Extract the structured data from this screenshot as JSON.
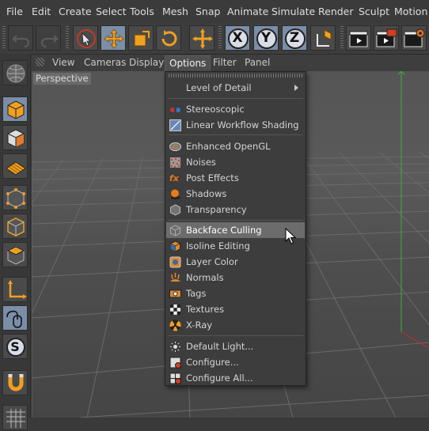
{
  "menubar": {
    "items": [
      "File",
      "Edit",
      "Create",
      "Select",
      "Tools",
      "Mesh",
      "Snap",
      "Animate",
      "Simulate",
      "Render",
      "Sculpt",
      "Motion T"
    ]
  },
  "toolbar": {
    "icons": [
      "undo-icon",
      "redo-icon",
      "live-selection-icon",
      "move-icon",
      "scale-icon",
      "rotate-icon",
      "last-tool-icon",
      "x-axis-icon",
      "y-axis-icon",
      "z-axis-icon",
      "coordinate-system-icon",
      "render-view-icon",
      "render-picture-viewer-icon",
      "render-settings-icon"
    ],
    "x_label": "X",
    "y_label": "Y",
    "z_label": "Z"
  },
  "viewport_menu": {
    "items": [
      "View",
      "Cameras",
      "Display",
      "Options",
      "Filter",
      "Panel"
    ],
    "open_item": "Options"
  },
  "viewport": {
    "camera_label": "Perspective"
  },
  "options_menu": {
    "items": [
      {
        "label": "Level of Detail",
        "icon": "none",
        "submenu": true
      },
      {
        "label": "Stereoscopic",
        "icon": "stereoscopic-icon"
      },
      {
        "label": "Linear Workflow Shading",
        "icon": "linear-workflow-icon"
      },
      {
        "label": "Enhanced OpenGL",
        "icon": "enhanced-opengl-icon"
      },
      {
        "label": "Noises",
        "icon": "noises-icon"
      },
      {
        "label": "Post Effects",
        "icon": "fx-icon"
      },
      {
        "label": "Shadows",
        "icon": "shadows-icon"
      },
      {
        "label": "Transparency",
        "icon": "transparency-icon"
      },
      {
        "label": "Backface Culling",
        "icon": "backface-culling-icon",
        "highlighted": true
      },
      {
        "label": "Isoline Editing",
        "icon": "isoline-editing-icon"
      },
      {
        "label": "Layer Color",
        "icon": "layer-color-icon"
      },
      {
        "label": "Normals",
        "icon": "normals-icon"
      },
      {
        "label": "Tags",
        "icon": "tags-icon"
      },
      {
        "label": "Textures",
        "icon": "textures-icon"
      },
      {
        "label": "X-Ray",
        "icon": "x-ray-icon"
      },
      {
        "label": "Default Light...",
        "icon": "default-light-icon"
      },
      {
        "label": "Configure...",
        "icon": "configure-icon"
      },
      {
        "label": "Configure All...",
        "icon": "configure-all-icon"
      }
    ]
  },
  "left_toolbar": {
    "icons": [
      "viewport-layout-icon",
      "model-mode-icon",
      "texture-mode-icon",
      "workplane-mode-icon",
      "points-mode-icon",
      "edges-mode-icon",
      "polygons-mode-icon",
      "axis-mode-icon",
      "tweak-mode-icon",
      "solo-mode-icon",
      "magnet-icon",
      "grid-icon"
    ],
    "solo_label": "S"
  },
  "colors": {
    "accent_selected": "#7a8ea8",
    "menu_highlight": "#6c6c6c",
    "axis_green": "#3fae3f",
    "axis_red": "#c0302c"
  }
}
